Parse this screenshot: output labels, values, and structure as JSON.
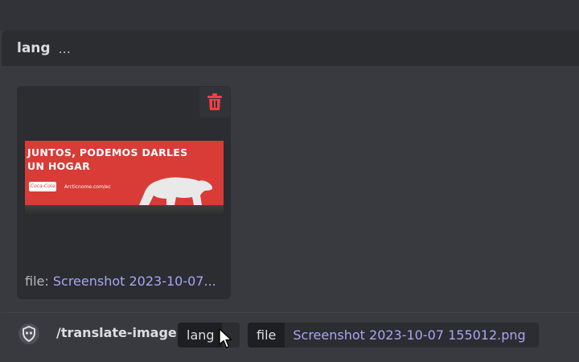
{
  "option_header": {
    "name": "lang",
    "description": "..."
  },
  "attachment": {
    "preview_image": {
      "headline_line1": "JUNTOS, PODEMOS DARLES",
      "headline_line2": "UN HOGAR",
      "logo_text": "Coca-Cola",
      "url_text": "Arcticnome.com/ec"
    },
    "caption_label": "file:",
    "caption_value": "Screenshot 2023-10-07..."
  },
  "command_bar": {
    "command": "/translate-image",
    "lang_option": "lang",
    "file_option": "file",
    "file_value": "Screenshot 2023-10-07 155012.png"
  },
  "colors": {
    "accent_link": "#a8a6f5",
    "delete_red": "#f23f43",
    "billboard_red": "#d93b37"
  },
  "icons": {
    "delete": "trash-icon",
    "bot": "bot-shield-icon",
    "cursor": "mouse-cursor-icon"
  }
}
